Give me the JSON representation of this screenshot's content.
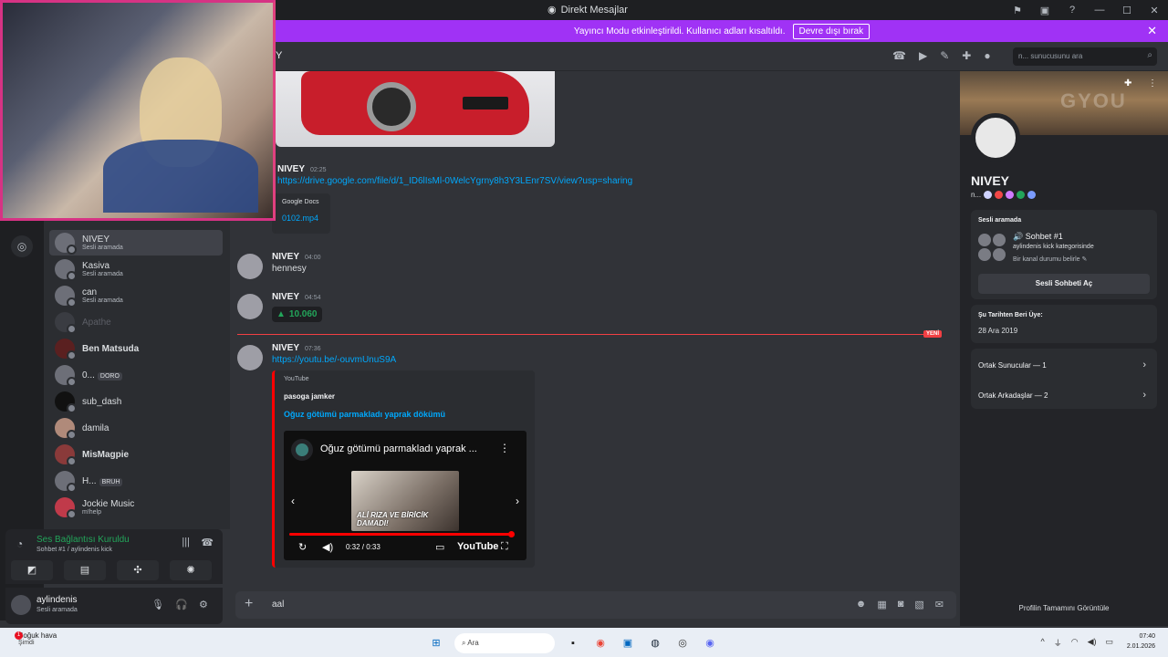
{
  "window": {
    "title": "Direkt Mesajlar"
  },
  "banner": {
    "text": "Yayıncı Modu etkinleştirildi. Kullanıcı adları kısaltıldı.",
    "button": "Devre dışı bırak"
  },
  "header": {
    "name": "Y",
    "search_placeholder": "n... sunucusunu ara"
  },
  "dm_list": [
    {
      "name": "NIVEY",
      "status": "Sesli aramada",
      "active": true
    },
    {
      "name": "Kasiva",
      "status": "Sesli aramada"
    },
    {
      "name": "can",
      "status": "Sesli aramada"
    },
    {
      "name": "Apathe",
      "status": "",
      "dim": true
    },
    {
      "name": "Ben Matsuda",
      "status": ""
    },
    {
      "name": "0...",
      "status": "",
      "badge": "DORO"
    },
    {
      "name": "sub_dash",
      "status": ""
    },
    {
      "name": "damila",
      "status": ""
    },
    {
      "name": "MisMagpie",
      "status": ""
    },
    {
      "name": "H...",
      "status": "",
      "badge": "BRUH"
    },
    {
      "name": "Jockie Music",
      "status": "m!help"
    }
  ],
  "voice": {
    "title": "Ses Bağlantısı Kuruldu",
    "sub": "Sohbet #1 / aylindenis kick"
  },
  "user": {
    "name": "aylindenis",
    "status": "Sesli aramada"
  },
  "messages": {
    "m1": {
      "author": "NIVEY",
      "time": "02:25",
      "link": "https://drive.google.com/file/d/1_ID6lIsMl-0WelcYgrny8h3Y3LEnr7SV/view?usp=sharing",
      "provider": "Google Docs",
      "file": "0102.mp4"
    },
    "m2": {
      "author": "NIVEY",
      "time": "04:00",
      "text": "hennesy"
    },
    "m3": {
      "author": "NIVEY",
      "time": "04:54",
      "counter": "10.060"
    },
    "new_label": "YENİ",
    "m4": {
      "author": "NIVEY",
      "time": "07:36",
      "link": "https://youtu.be/-ouvmUnuS9A"
    }
  },
  "youtube": {
    "provider": "YouTube",
    "channel": "pasoga jamker",
    "title": "Oğuz götümü parmakladı yaprak dökümü",
    "player_title": "Oğuz götümü parmakladı yaprak ...",
    "thumb_caption": "ALİ RIZA VE BİRİCİK DAMADI!",
    "time": "0:32 / 0:33",
    "progress": 0.97,
    "logo": "YouTube"
  },
  "composer": {
    "text": "aal"
  },
  "profile": {
    "name": "NIVEY",
    "short": "n...",
    "voice_title": "Sesli aramada",
    "channel": "Sohbet #1",
    "category": "aylindenis kick kategorisinde",
    "channel_status": "Bir kanal durumu belirle",
    "open_button": "Sesli Sohbeti Aç",
    "member_since_label": "Şu Tarihten Beri Üye:",
    "member_since": "28 Ara 2019",
    "mutual_servers": "Ortak Sunucular — 1",
    "mutual_friends": "Ortak Arkadaşlar — 2",
    "footer": "Profilin Tamamını Görüntüle",
    "banner_text": "GYOU"
  },
  "taskbar": {
    "weather": "Soğuk hava",
    "weather_sub": "Şimdi",
    "weather_badge": "1",
    "search": "Ara",
    "time": "07:40",
    "date": "2.01.2026"
  }
}
